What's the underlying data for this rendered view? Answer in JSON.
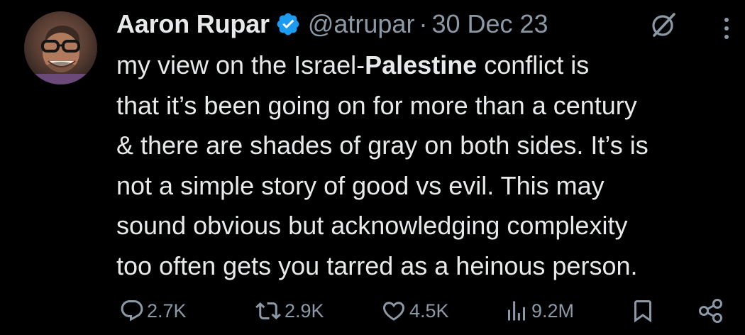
{
  "author": {
    "name": "Aaron Rupar",
    "handle": "@atrupar",
    "separator": "·",
    "date": "30 Dec 23"
  },
  "body": {
    "line1_pre": "my view on the Israel-",
    "line1_bold": "Palestine",
    "line1_post": " conflict is",
    "line2": "that it’s been going on for more than a century",
    "line3": "& there are shades of gray on both sides. It’s is",
    "line4": "not a simple story of good vs evil. This may",
    "line5": "sound obvious but acknowledging complexity",
    "line6": "too often gets you tarred as a heinous person."
  },
  "stats": {
    "replies": "2.7K",
    "reposts": "2.9K",
    "likes": "4.5K",
    "views": "9.2M"
  },
  "icons": {
    "verified": "verified-badge-icon",
    "grok": "grok-icon",
    "more": "more-icon",
    "reply": "reply-icon",
    "repost": "repost-icon",
    "like": "like-icon",
    "views": "views-icon",
    "bookmark": "bookmark-icon",
    "share": "share-icon"
  },
  "colors": {
    "background": "#000000",
    "text": "#e7e9ea",
    "secondary": "#8b98a5",
    "verified": "#1d9bf0"
  }
}
